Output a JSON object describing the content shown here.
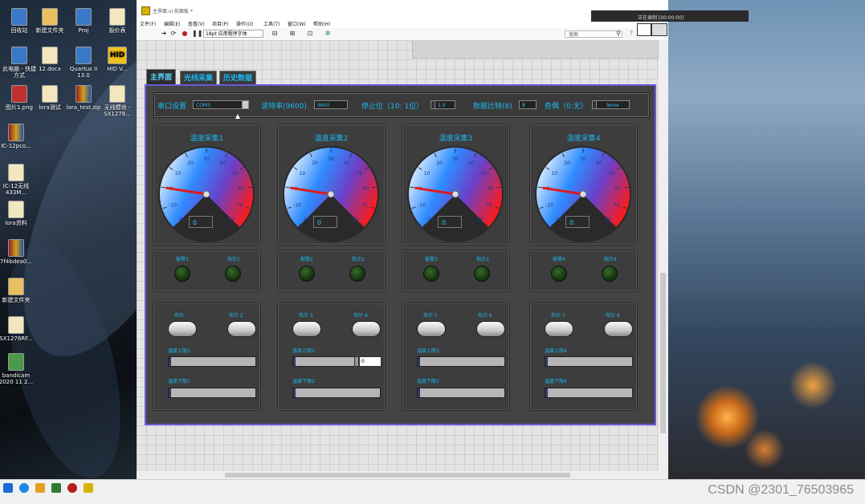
{
  "desktop": {
    "icons": [
      {
        "label": "回收站",
        "glyph": "blue"
      },
      {
        "label": "新建文件夹",
        "glyph": "folder"
      },
      {
        "label": "Proj",
        "glyph": "blue"
      },
      {
        "label": "报价表",
        "glyph": ""
      },
      {
        "label": "此电脑 - 快捷方式",
        "glyph": "blue"
      },
      {
        "label": "12.docx",
        "glyph": ""
      },
      {
        "label": "Quartus II 13.0",
        "glyph": "blue"
      },
      {
        "label": "HID",
        "glyph": "hid"
      },
      {
        "label": "HID V...",
        "glyph": ""
      },
      {
        "label": "图片1.png",
        "glyph": "red"
      },
      {
        "label": "lora测试",
        "glyph": ""
      },
      {
        "label": "lora_test.zip",
        "glyph": "rar"
      },
      {
        "label": "无线模块 -SX1278...",
        "glyph": ""
      },
      {
        "label": "IC-12pco...",
        "glyph": "rar"
      },
      {
        "label": "IC-12无线 433M...",
        "glyph": ""
      },
      {
        "label": "lora资料",
        "glyph": ""
      },
      {
        "label": "7f4bdea0...",
        "glyph": "rar"
      },
      {
        "label": "新建文件夹",
        "glyph": "folder"
      },
      {
        "label": "SX1276RF...",
        "glyph": ""
      },
      {
        "label": "bandicam 2020 11 2...",
        "glyph": "green"
      }
    ],
    "hid_text": "HID"
  },
  "window": {
    "title": "主界面.vi 前面板 *",
    "menu": [
      "文件(F)",
      "编辑(E)",
      "查看(V)",
      "项目(P)",
      "操作(O)",
      "工具(T)",
      "窗口(W)",
      "帮助(H)"
    ],
    "font_select": "18pt 应用程序字体",
    "search_placeholder": "搜索",
    "recording": "正在录制 [00:00:00]"
  },
  "tabs": [
    {
      "label": "主界面",
      "active": true
    },
    {
      "label": "光线采集",
      "active": false
    },
    {
      "label": "历史数据",
      "active": false
    }
  ],
  "serial": {
    "port_label": "串口设置",
    "port_value": "COM3",
    "baud_label": "波特率(9600)",
    "baud_value": "9600",
    "stop_label": "停止位（10: 1位）",
    "stop_value": "1.0",
    "data_bits_label": "数据比特(8)",
    "data_bits_value": "8",
    "parity_label": "奇偶（0:无）",
    "parity_value": "None"
  },
  "gauges": [
    {
      "title": "温度采集1",
      "value": "0",
      "needle_value": 0
    },
    {
      "title": "温度采集2",
      "value": "0",
      "needle_value": 0
    },
    {
      "title": "温度采集3",
      "value": "0",
      "needle_value": 0
    },
    {
      "title": "温度采集4",
      "value": "0",
      "needle_value": 0
    }
  ],
  "gauge_ticks": [
    "-20",
    "-10",
    "0",
    "10",
    "20",
    "30",
    "40",
    "50",
    "60",
    "70",
    "80"
  ],
  "gauge_scale": {
    "min": -20,
    "max": 80
  },
  "leds": [
    {
      "a": "报警1",
      "b": "指示1"
    },
    {
      "a": "报警2",
      "b": "指示2"
    },
    {
      "a": "报警3",
      "b": "指示3"
    },
    {
      "a": "报警4",
      "b": "指示4"
    }
  ],
  "controls": [
    {
      "sw1": "布尔",
      "sw2": "布尔 2",
      "upper": "温度上限1",
      "lower": "温度下限1",
      "upper_value": ""
    },
    {
      "sw1": "布尔 3",
      "sw2": "布尔 4",
      "upper": "温度上限2",
      "lower": "温度下限2",
      "upper_value": "0"
    },
    {
      "sw1": "布尔 5",
      "sw2": "布尔 6",
      "upper": "温度上限3",
      "lower": "温度下限3",
      "upper_value": ""
    },
    {
      "sw1": "布尔 7",
      "sw2": "布尔 8",
      "upper": "温度上限4",
      "lower": "温度下限4",
      "upper_value": ""
    }
  ],
  "watermark": "CSDN @2301_76503965",
  "colors": {
    "label": "#1ab8f0",
    "frame": "#6a5ad8",
    "panel": "#444444"
  }
}
